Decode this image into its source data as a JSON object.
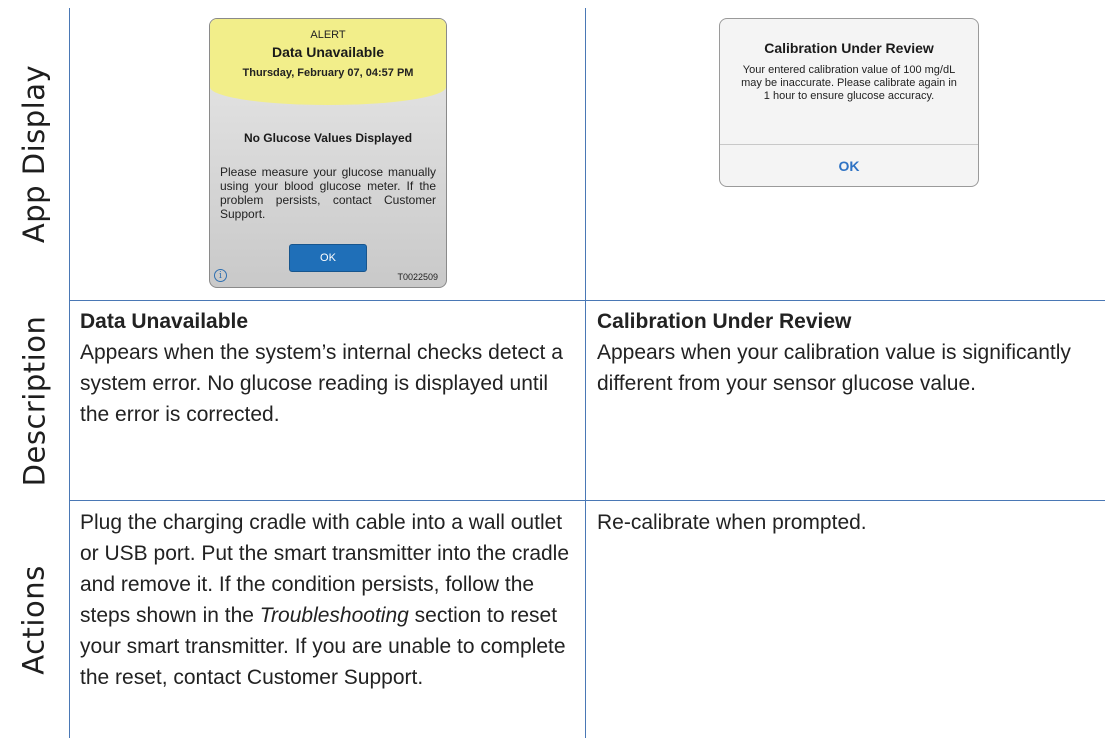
{
  "rows": {
    "app_display": "App Display",
    "description": "Description",
    "actions": "Actions"
  },
  "left_alert": {
    "kicker": "ALERT",
    "title": "Data Unavailable",
    "date": "Thursday, February 07, 04:57 PM",
    "subtitle": "No Glucose Values Displayed",
    "message": "Please measure your glucose manually using your blood glucose meter. If the problem persists, contact Customer Support.",
    "ok_label": "OK",
    "info_glyph": "i",
    "code": "T0022509"
  },
  "right_alert": {
    "title": "Calibration Under Review",
    "message": "Your entered calibration value of 100 mg/dL may be inaccurate. Please calibrate again in 1 hour to ensure glucose accuracy.",
    "ok_label": "OK"
  },
  "description": {
    "left_title": "Data Unavailable",
    "left_body": "Appears when the system’s internal checks detect a system error. No glucose reading is displayed until the error is corrected.",
    "right_title": "Calibration Under Review",
    "right_body": "Appears when your calibration value is significantly different from your sensor glucose value."
  },
  "actions": {
    "left_before": "Plug the charging cradle with cable into a wall outlet or USB port. Put the smart transmitter into the cradle and remove it. If the condition persists, follow the steps shown in the ",
    "left_emphasis": "Troubleshooting",
    "left_after": " section to reset your smart transmitter. If you are unable to complete the reset, contact Customer Support.",
    "right": "Re-calibrate when prompted."
  },
  "colors": {
    "rule": "#4a78b5",
    "alert_banner": "#f2ee8a",
    "alert_button": "#1f6fb8",
    "ios_ok": "#2f73c4"
  }
}
